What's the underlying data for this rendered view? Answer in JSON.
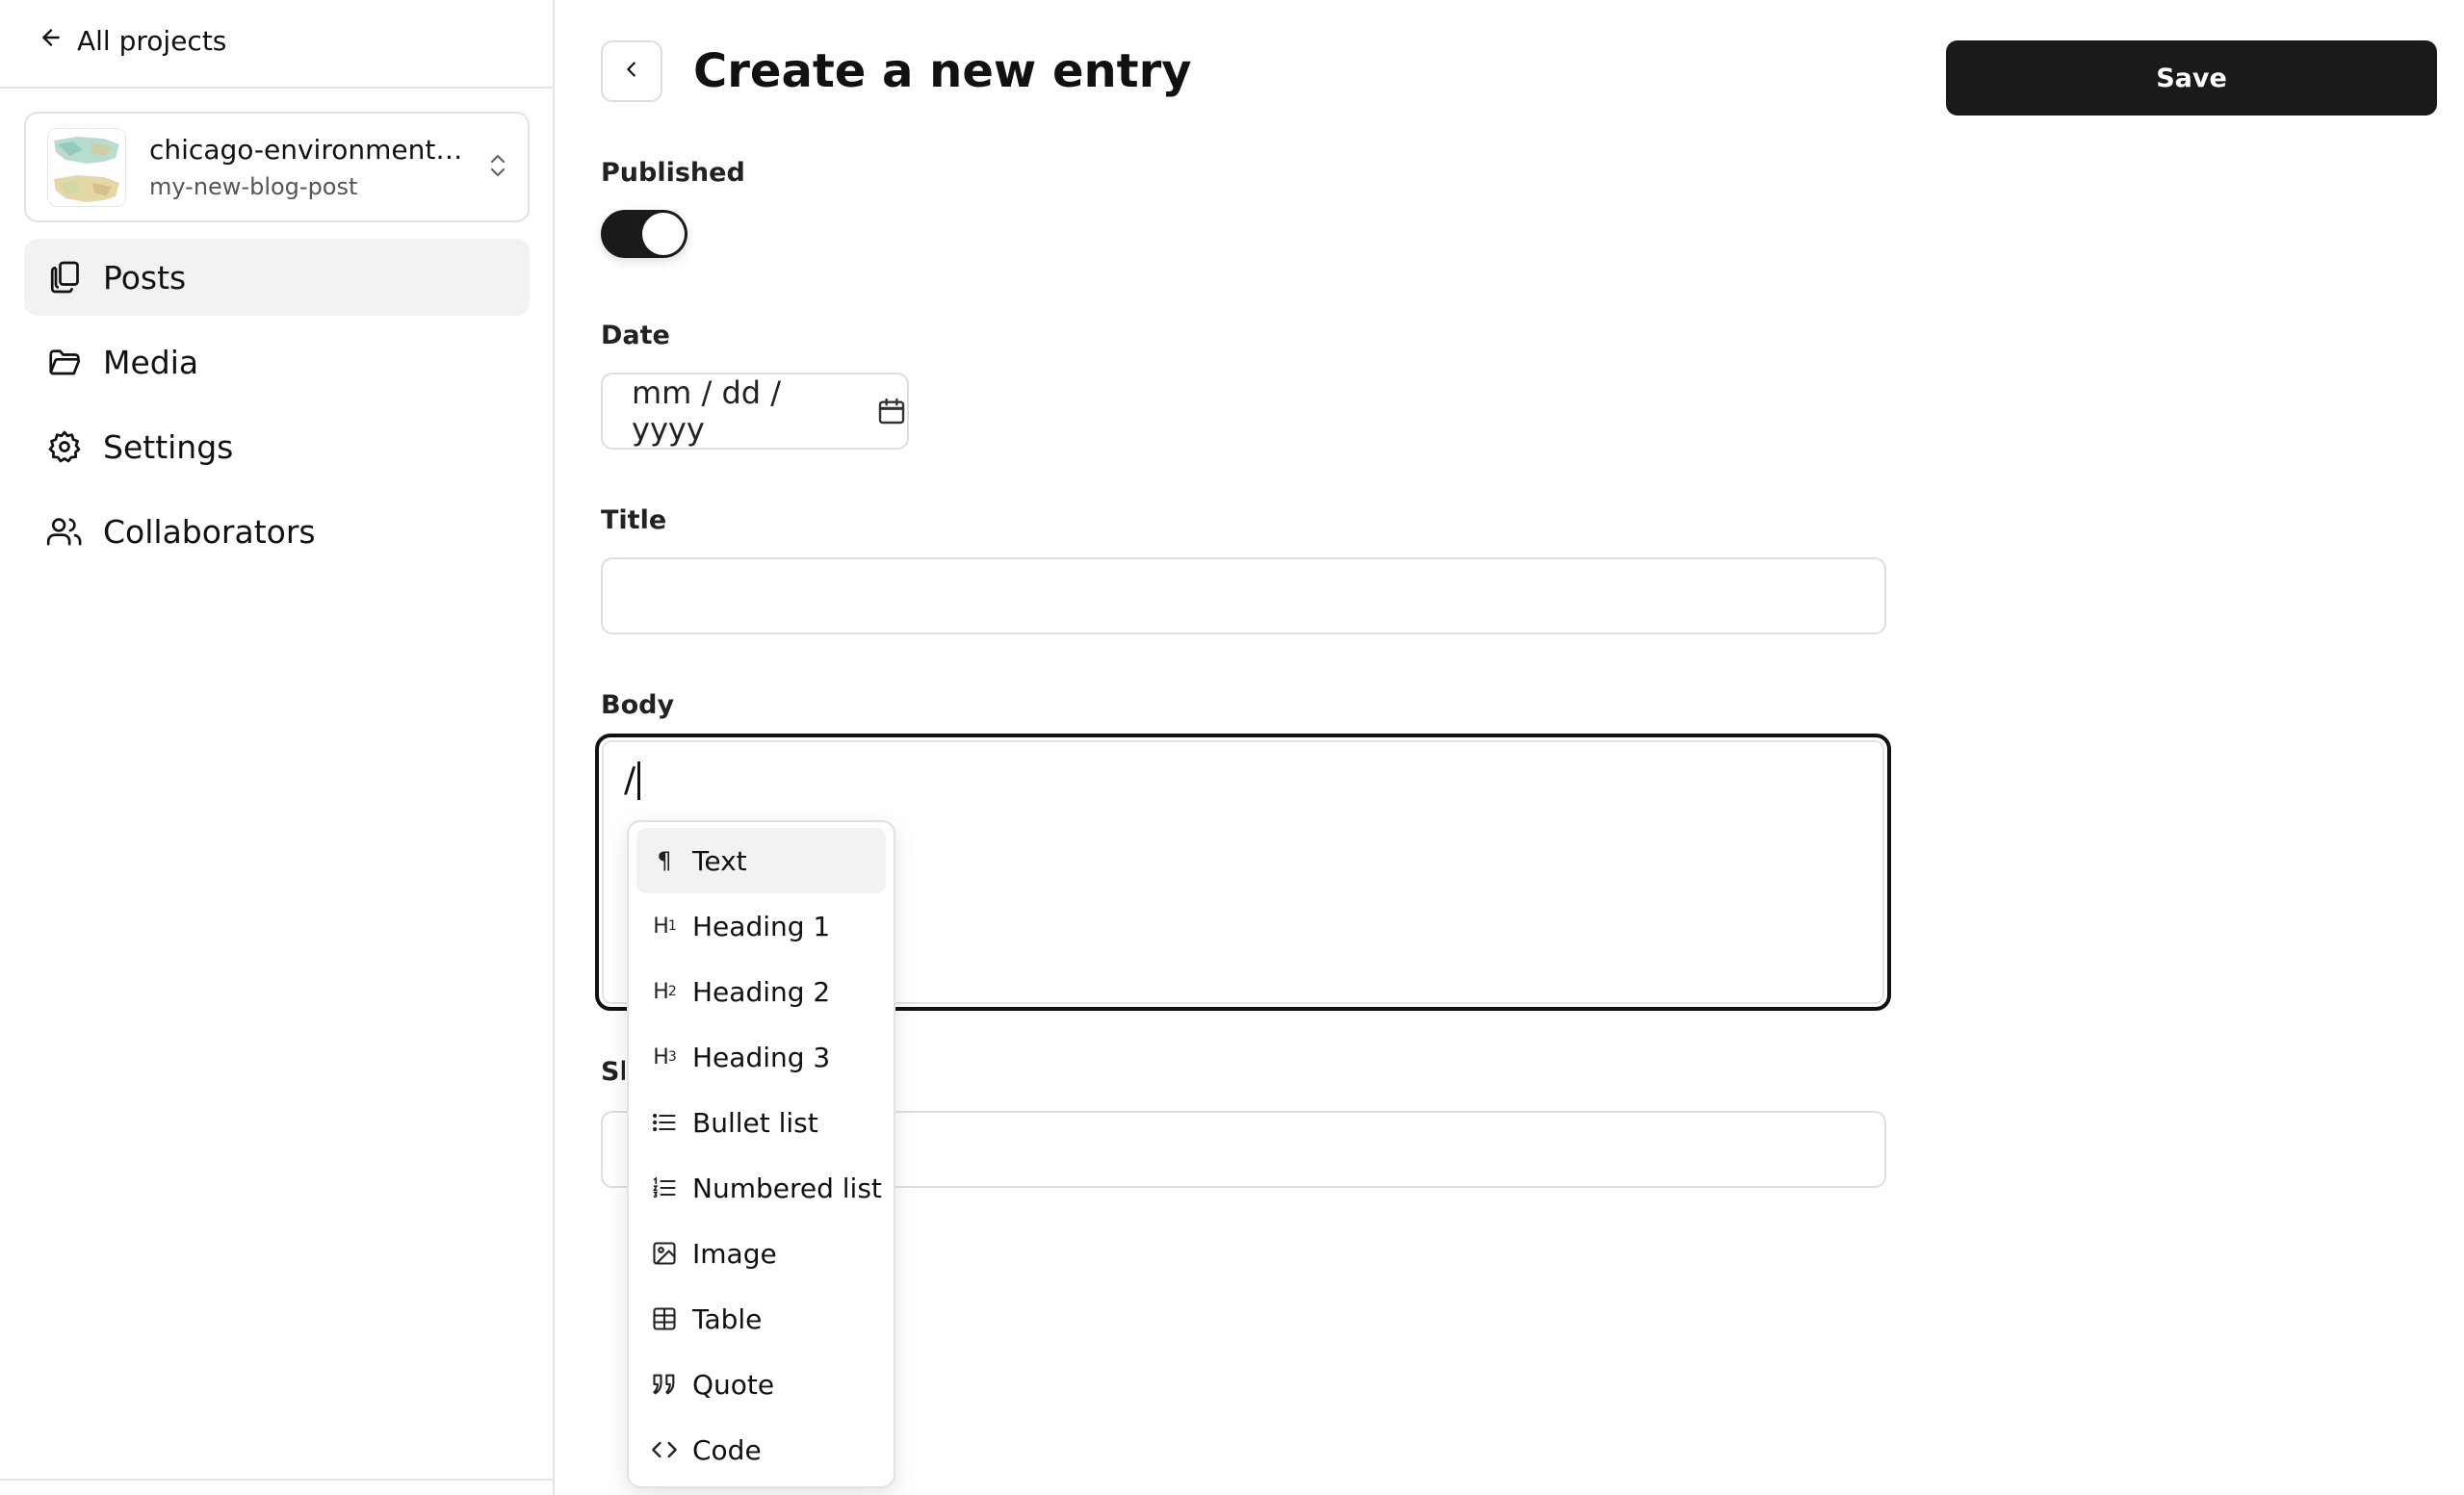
{
  "sidebar": {
    "back_label": "All projects",
    "project": {
      "name": "chicago-environment-ex...",
      "subtitle": "my-new-blog-post"
    },
    "items": [
      {
        "label": "Posts",
        "icon": "posts-icon",
        "active": true
      },
      {
        "label": "Media",
        "icon": "folder-icon",
        "active": false
      },
      {
        "label": "Settings",
        "icon": "gear-icon",
        "active": false
      },
      {
        "label": "Collaborators",
        "icon": "users-icon",
        "active": false
      }
    ]
  },
  "header": {
    "title": "Create a new entry",
    "save_label": "Save"
  },
  "form": {
    "published": {
      "label": "Published",
      "value": true
    },
    "date": {
      "label": "Date",
      "placeholder": "mm / dd / yyyy"
    },
    "title": {
      "label": "Title",
      "value": ""
    },
    "body": {
      "label": "Body",
      "value": "/"
    },
    "slug": {
      "label": "Sl",
      "value": ""
    }
  },
  "slash_menu": {
    "items": [
      {
        "label": "Text",
        "icon": "paragraph-icon",
        "active": true
      },
      {
        "label": "Heading 1",
        "icon": "heading-1-icon",
        "active": false
      },
      {
        "label": "Heading 2",
        "icon": "heading-2-icon",
        "active": false
      },
      {
        "label": "Heading 3",
        "icon": "heading-3-icon",
        "active": false
      },
      {
        "label": "Bullet list",
        "icon": "bullet-list-icon",
        "active": false
      },
      {
        "label": "Numbered list",
        "icon": "numbered-list-icon",
        "active": false
      },
      {
        "label": "Image",
        "icon": "image-icon",
        "active": false
      },
      {
        "label": "Table",
        "icon": "table-icon",
        "active": false
      },
      {
        "label": "Quote",
        "icon": "quote-icon",
        "active": false
      },
      {
        "label": "Code",
        "icon": "code-icon",
        "active": false
      }
    ]
  },
  "colors": {
    "primary": "#1a1a1a",
    "border": "#dedede",
    "active_bg": "#f2f2f2"
  }
}
